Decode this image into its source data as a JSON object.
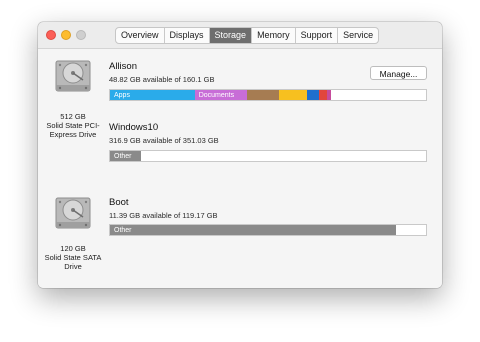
{
  "tabs": [
    {
      "label": "Overview"
    },
    {
      "label": "Displays"
    },
    {
      "label": "Storage"
    },
    {
      "label": "Memory"
    },
    {
      "label": "Support"
    },
    {
      "label": "Service"
    }
  ],
  "active_tab": "Storage",
  "disks": [
    {
      "caption": [
        "512 GB",
        "Solid State PCI-",
        "Express Drive"
      ],
      "volumes": [
        {
          "name": "Allison",
          "available": "48.82 GB available of 160.1 GB",
          "manage_label": "Manage...",
          "segments": [
            {
              "label": "Apps",
              "fraction": 0.268,
              "color": "#2aabea"
            },
            {
              "label": "Documents",
              "fraction": 0.165,
              "color": "#c86dd7"
            },
            {
              "label": "",
              "fraction": 0.101,
              "color": "#a67c52"
            },
            {
              "label": "",
              "fraction": 0.09,
              "color": "#f7c01f"
            },
            {
              "label": "",
              "fraction": 0.037,
              "color": "#1e6fce"
            },
            {
              "label": "",
              "fraction": 0.025,
              "color": "#e1463d"
            },
            {
              "label": "",
              "fraction": 0.012,
              "color": "#c64c9c"
            }
          ]
        },
        {
          "name": "Windows10",
          "available": "316.9 GB available of 351.03 GB",
          "segments": [
            {
              "label": "Other",
              "fraction": 0.097,
              "color": "#8a8a8a"
            }
          ]
        }
      ]
    },
    {
      "caption": [
        "120 GB",
        "Solid State SATA",
        "Drive"
      ],
      "volumes": [
        {
          "name": "Boot",
          "available": "11.39 GB available of 119.17 GB",
          "segments": [
            {
              "label": "Other",
              "fraction": 0.904,
              "color": "#8a8a8a"
            }
          ]
        }
      ]
    }
  ]
}
